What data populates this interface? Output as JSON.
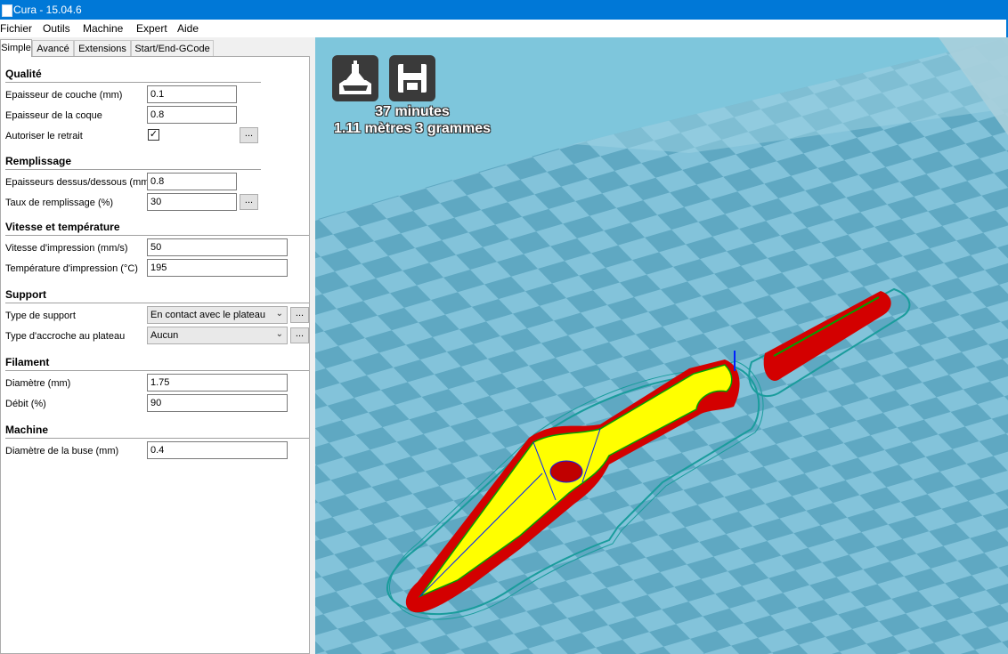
{
  "window": {
    "title": "Cura - 15.04.6"
  },
  "menu": [
    "Fichier",
    "Outils",
    "Machine",
    "Expert",
    "Aide"
  ],
  "tabs": [
    "Simple",
    "Avancé",
    "Extensions",
    "Start/End-GCode"
  ],
  "sections": {
    "quality": {
      "title": "Qualité",
      "layer_height_label": "Epaisseur de couche (mm)",
      "layer_height": "0.1",
      "shell_label": "Epaisseur de la coque",
      "shell": "0.8",
      "retraction_label": "Autoriser le retrait",
      "retraction_checked": true
    },
    "fill": {
      "title": "Remplissage",
      "top_bottom_label": "Epaisseurs dessus/dessous (mm)",
      "top_bottom": "0.8",
      "density_label": "Taux de remplissage (%)",
      "density": "30"
    },
    "speed": {
      "title": "Vitesse et température",
      "print_speed_label": "Vitesse d'impression (mm/s)",
      "print_speed": "50",
      "temp_label": "Température d'impression (°C)",
      "temp": "195"
    },
    "support": {
      "title": "Support",
      "type_label": "Type de support",
      "type": "En contact avec le plateau",
      "adhesion_label": "Type d'accroche au plateau",
      "adhesion": "Aucun"
    },
    "filament": {
      "title": "Filament",
      "diameter_label": "Diamètre (mm)",
      "diameter": "1.75",
      "flow_label": "Débit (%)",
      "flow": "90"
    },
    "machine": {
      "title": "Machine",
      "nozzle_label": "Diamètre de la buse (mm)",
      "nozzle": "0.4"
    }
  },
  "more_button": "...",
  "viewport": {
    "print_time": "37 minutes",
    "material": "1.11 mètres 3 grammes",
    "load_icon": "load-model-icon",
    "save_icon": "save-toolpath-icon"
  },
  "colors": {
    "titlebar": "#0078d7",
    "plate_light": "#83c3da",
    "plate_dark": "#5fa8c2",
    "model_wall": "#e00000",
    "model_infill": "#ffff00",
    "skirt": "#1a9c9c"
  }
}
